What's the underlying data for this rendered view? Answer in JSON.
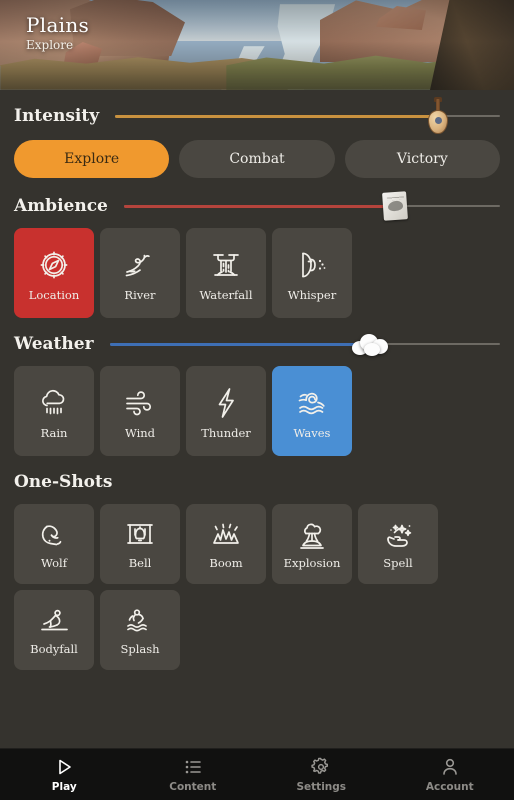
{
  "header": {
    "title": "Plains",
    "subtitle": "Explore",
    "art_name": "plains-river-canyon-artwork"
  },
  "theme": {
    "page_bg": "#35332E",
    "tile_bg": "#4A4741",
    "accent_orange": "#F0992E",
    "accent_red": "#C8312E",
    "accent_blue": "#4A8FD4",
    "nav_bg": "#111110",
    "text": "#F2F0EA"
  },
  "sections": {
    "intensity": {
      "title": "Intensity",
      "slider": {
        "value_pct": 84,
        "fill_color": "#C9923F",
        "thumb_icon": "lute-icon"
      },
      "pills": [
        {
          "label": "Explore",
          "active": true
        },
        {
          "label": "Combat",
          "active": false
        },
        {
          "label": "Victory",
          "active": false
        }
      ]
    },
    "ambience": {
      "title": "Ambience",
      "slider": {
        "value_pct": 72,
        "fill_color": "#B5443C",
        "thumb_icon": "scroll-map-icon"
      },
      "tiles": [
        {
          "label": "Location",
          "icon": "compass-icon",
          "active": true
        },
        {
          "label": "River",
          "icon": "river-icon",
          "active": false
        },
        {
          "label": "Waterfall",
          "icon": "waterfall-icon",
          "active": false
        },
        {
          "label": "Whisper",
          "icon": "whisper-icon",
          "active": false
        }
      ]
    },
    "weather": {
      "title": "Weather",
      "slider": {
        "value_pct": 66,
        "fill_color": "#3E6FB5",
        "thumb_icon": "cloud-icon"
      },
      "tiles": [
        {
          "label": "Rain",
          "icon": "rain-cloud-icon",
          "active": false
        },
        {
          "label": "Wind",
          "icon": "wind-icon",
          "active": false
        },
        {
          "label": "Thunder",
          "icon": "lightning-bolt-icon",
          "active": false
        },
        {
          "label": "Waves",
          "icon": "waves-icon",
          "active": true
        }
      ]
    },
    "oneshots": {
      "title": "One-Shots",
      "tiles": [
        {
          "label": "Wolf",
          "icon": "wolf-howl-icon"
        },
        {
          "label": "Bell",
          "icon": "bell-icon"
        },
        {
          "label": "Boom",
          "icon": "boom-burst-icon"
        },
        {
          "label": "Explosion",
          "icon": "mushroom-cloud-icon"
        },
        {
          "label": "Spell",
          "icon": "spell-hand-icon"
        },
        {
          "label": "Bodyfall",
          "icon": "bodyfall-icon"
        },
        {
          "label": "Splash",
          "icon": "splash-icon"
        }
      ]
    }
  },
  "navbar": [
    {
      "label": "Play",
      "icon": "play-triangle-icon",
      "active": true
    },
    {
      "label": "Content",
      "icon": "list-icon",
      "active": false
    },
    {
      "label": "Settings",
      "icon": "gear-icon",
      "active": false
    },
    {
      "label": "Account",
      "icon": "person-icon",
      "active": false
    }
  ]
}
